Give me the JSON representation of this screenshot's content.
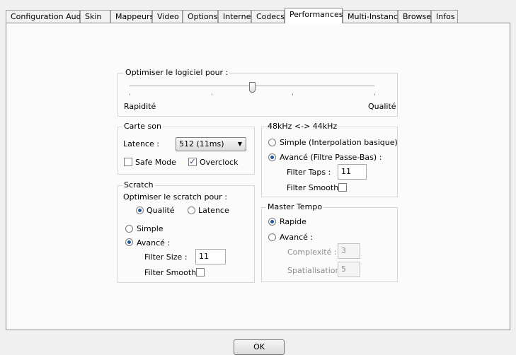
{
  "tabs": [
    {
      "label": "Configuration Audio"
    },
    {
      "label": "Skin"
    },
    {
      "label": "Mappeurs"
    },
    {
      "label": "Video"
    },
    {
      "label": "Options"
    },
    {
      "label": "Internet"
    },
    {
      "label": "Codecs"
    },
    {
      "label": "Performances",
      "active": true
    },
    {
      "label": "Multi-Instance"
    },
    {
      "label": "Browser"
    },
    {
      "label": "Infos"
    }
  ],
  "optimize": {
    "title": "Optimiser le logiciel pour :",
    "left_label": "Rapidité",
    "right_label": "Qualité",
    "slider_value": 0.5
  },
  "soundcard": {
    "title": "Carte son",
    "latency_label": "Latence :",
    "latency_value": "512 (11ms)",
    "safe_mode_label": "Safe Mode",
    "safe_mode_checked": false,
    "overclock_label": "Overclock",
    "overclock_checked": true
  },
  "scratch": {
    "title": "Scratch",
    "optimize_label": "Optimiser le scratch pour :",
    "quality_label": "Qualité",
    "latency_label": "Latence",
    "simple_label": "Simple",
    "advanced_label": "Avancé :",
    "filter_size_label": "Filter Size :",
    "filter_size_value": "11",
    "filter_smooth_label": "Filter Smooth"
  },
  "resample": {
    "title": "48kHz <-> 44kHz",
    "simple_label": "Simple (Interpolation basique)",
    "advanced_label": "Avancé (Filtre Passe-Bas) :",
    "filter_taps_label": "Filter Taps :",
    "filter_taps_value": "11",
    "filter_smooth_label": "Filter Smooth"
  },
  "master_tempo": {
    "title": "Master Tempo",
    "rapid_label": "Rapide",
    "advanced_label": "Avancé :",
    "complexity_label": "Complexité :",
    "complexity_value": "3",
    "spatialisation_label": "Spatialisation :",
    "spatialisation_value": "5"
  },
  "ok_label": "OK",
  "check_glyph": "✓",
  "select_arrow": "▼"
}
